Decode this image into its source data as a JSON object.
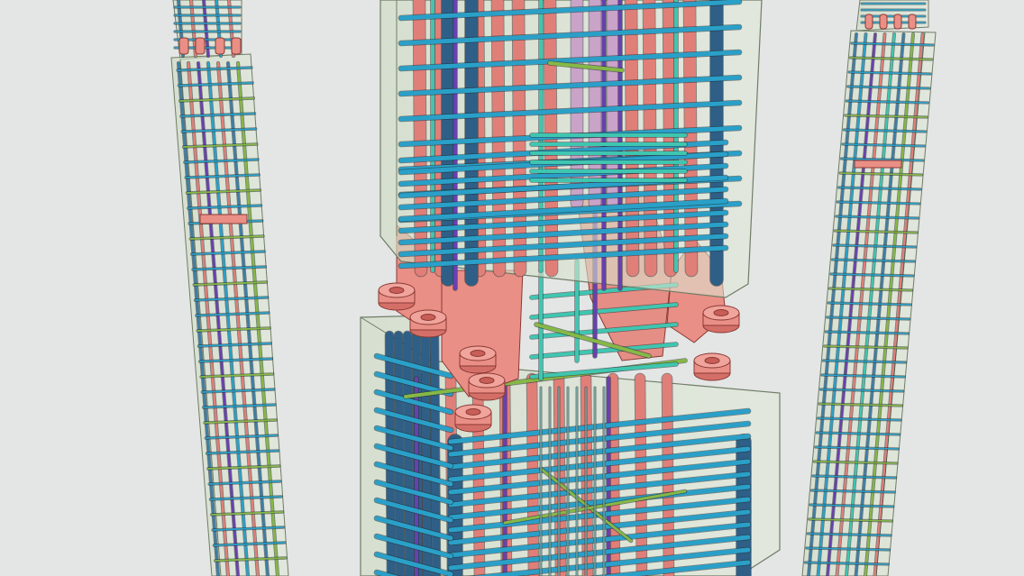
{
  "scene": {
    "kind": "3d-bim-rebar-model",
    "background_color": "#e4e5e5",
    "colors": {
      "concrete_fill": "#d6e3cc",
      "concrete_edge": "#6f7d66",
      "long_bar_blue": "#3d7ea6",
      "long_bar_navy": "#2f5f86",
      "long_bar_pink": "#e07f78",
      "long_bar_lilac": "#c9a3c8",
      "stirrup_blue": "#2aa0c8",
      "stirrup_cyan": "#3fc6b0",
      "tie_green": "#86b846",
      "tie_purple": "#6a3fb0",
      "coupler_salmon": "#e98f86",
      "coupler_edge": "#8a3a35"
    },
    "objects": [
      {
        "id": "left-column",
        "label": ""
      },
      {
        "id": "center-upper-column",
        "label": ""
      },
      {
        "id": "center-lower-column",
        "label": ""
      },
      {
        "id": "splice-connection",
        "label": ""
      },
      {
        "id": "right-column",
        "label": ""
      }
    ]
  }
}
